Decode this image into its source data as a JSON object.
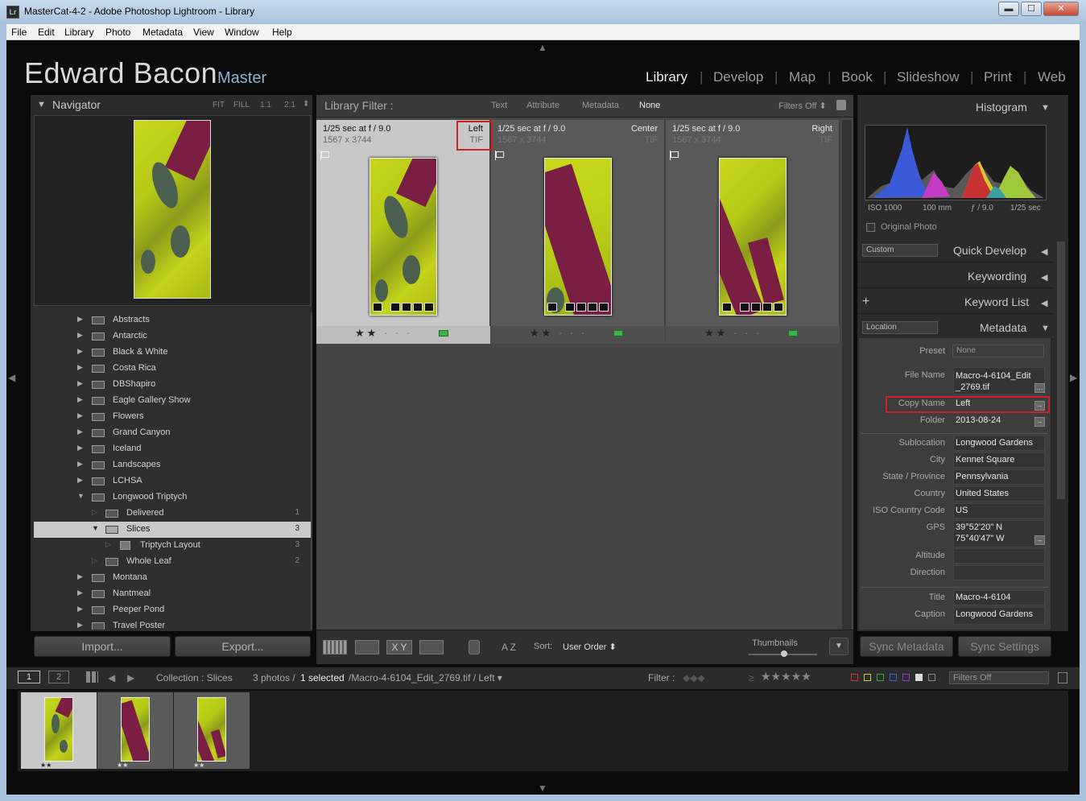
{
  "window": {
    "title": "MasterCat-4-2 - Adobe Photoshop Lightroom - Library",
    "app_icon": "Lr",
    "controls": {
      "minimize": "▬",
      "maximize": "☐",
      "close": "✕"
    }
  },
  "menu": [
    "File",
    "Edit",
    "Library",
    "Photo",
    "Metadata",
    "View",
    "Window",
    "Help"
  ],
  "identity": {
    "name": "Edward Bacon",
    "tag": "Master"
  },
  "modules": {
    "library": "Library",
    "develop": "Develop",
    "map": "Map",
    "book": "Book",
    "slideshow": "Slideshow",
    "print": "Print",
    "web": "Web",
    "sep": "|"
  },
  "navigator": {
    "title": "Navigator",
    "zoom": {
      "fit": "FIT",
      "fill": "FILL",
      "one": "1:1",
      "two": "2:1"
    }
  },
  "collections": [
    {
      "name": "Abstracts",
      "count": ""
    },
    {
      "name": "Antarctic",
      "count": ""
    },
    {
      "name": "Black & White",
      "count": ""
    },
    {
      "name": "Costa Rica",
      "count": ""
    },
    {
      "name": "DBShapiro",
      "count": ""
    },
    {
      "name": "Eagle Gallery Show",
      "count": ""
    },
    {
      "name": "Flowers",
      "count": ""
    },
    {
      "name": "Grand Canyon",
      "count": ""
    },
    {
      "name": "Iceland",
      "count": ""
    },
    {
      "name": "Landscapes",
      "count": ""
    },
    {
      "name": "LCHSA",
      "count": ""
    },
    {
      "name": "Longwood Triptych",
      "count": ""
    },
    {
      "name": "Delivered",
      "count": "1"
    },
    {
      "name": "Slices",
      "count": "3"
    },
    {
      "name": "Triptych Layout",
      "count": "3"
    },
    {
      "name": "Whole Leaf",
      "count": "2"
    },
    {
      "name": "Montana",
      "count": ""
    },
    {
      "name": "Nantmeal",
      "count": ""
    },
    {
      "name": "Peeper Pond",
      "count": ""
    },
    {
      "name": "Travel Poster",
      "count": ""
    }
  ],
  "left_buttons": {
    "import": "Import...",
    "export": "Export..."
  },
  "filter_bar": {
    "title": "Library Filter :",
    "text": "Text",
    "attribute": "Attribute",
    "metadata": "Metadata",
    "none": "None",
    "filters_off": "Filters Off ⬍"
  },
  "grid": [
    {
      "exposure": "1/25 sec at f / 9.0",
      "dims": "1567 x 3744",
      "copy": "Left",
      "type": "TIF",
      "stars": "★★",
      "dots": "· · ·"
    },
    {
      "exposure": "1/25 sec at f / 9.0",
      "dims": "1567 x 3744",
      "copy": "Center",
      "type": "TIF",
      "stars": "★★",
      "dots": "· · ·"
    },
    {
      "exposure": "1/25 sec at f / 9.0",
      "dims": "1567 x 3744",
      "copy": "Right",
      "type": "TIF",
      "stars": "★★",
      "dots": "· · ·"
    }
  ],
  "toolbar": {
    "sort_label": "Sort:",
    "sort_value": "User Order ⬍",
    "thumbnails_label": "Thumbnails",
    "az": "A Z",
    "xy": "X Y"
  },
  "histogram": {
    "title": "Histogram",
    "iso": "ISO 1000",
    "focal": "100 mm",
    "aperture": "ƒ / 9.0",
    "shutter": "1/25 sec",
    "original_photo": "Original Photo"
  },
  "quick_develop": {
    "title": "Quick Develop",
    "preset": "Custom"
  },
  "keywording": {
    "title": "Keywording"
  },
  "keyword_list": {
    "title": "Keyword List",
    "plus": "+"
  },
  "metadata": {
    "title": "Metadata",
    "view": "Location",
    "preset_label": "Preset",
    "preset_value": "None",
    "fields": {
      "file_name": {
        "label": "File Name",
        "value": "Macro-4-6104_Edit_2769.tif"
      },
      "copy_name": {
        "label": "Copy Name",
        "value": "Left"
      },
      "folder": {
        "label": "Folder",
        "value": "2013-08-24"
      },
      "sublocation": {
        "label": "Sublocation",
        "value": "Longwood Gardens"
      },
      "city": {
        "label": "City",
        "value": "Kennet Square"
      },
      "state": {
        "label": "State / Province",
        "value": "Pennsylvania"
      },
      "country": {
        "label": "Country",
        "value": "United States"
      },
      "iso_code": {
        "label": "ISO Country Code",
        "value": "US"
      },
      "gps": {
        "label": "GPS",
        "value1": "39°52'20\" N",
        "value2": "75°40'47\" W"
      },
      "altitude": {
        "label": "Altitude",
        "value": ""
      },
      "direction": {
        "label": "Direction",
        "value": ""
      },
      "title": {
        "label": "Title",
        "value": "Macro-4-6104"
      },
      "caption": {
        "label": "Caption",
        "value": "Longwood Gardens"
      }
    }
  },
  "sync": {
    "metadata": "Sync Metadata",
    "settings": "Sync Settings"
  },
  "filmstrip_bar": {
    "monitor1": "1",
    "monitor2": "2",
    "source": "Collection : Slices",
    "count": "3 photos /",
    "selected": "1 selected",
    "path": "/Macro-4-6104_Edit_2769.tif / Left ▾",
    "filter_label": "Filter :",
    "filters_off": "Filters Off",
    "rating_op": "≥",
    "rating_stars": "★★★★★"
  },
  "filmstrip": [
    {
      "stars": "★★"
    },
    {
      "stars": "★★"
    },
    {
      "stars": "★★"
    }
  ],
  "colors": {
    "background": "#0b0b0b",
    "panel": "#2e2e2e",
    "grid_bg": "#454545",
    "selected_cell": "#c8c8c8",
    "accent_blue": "#8cb3d6",
    "highlight_red": "#cc2424",
    "label_green": "#3bb34a"
  }
}
